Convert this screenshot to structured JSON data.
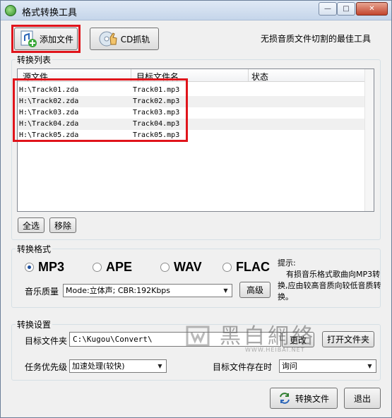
{
  "window": {
    "title": "格式转换工具",
    "min": "—",
    "max": "□",
    "close": "✕"
  },
  "toolbar": {
    "add_file": "添加文件",
    "cd_rip": "CD抓轨",
    "tagline": "无损音质文件切割的最佳工具"
  },
  "convert_list": {
    "label": "转换列表",
    "columns": [
      "源文件",
      "目标文件名",
      "状态"
    ],
    "rows": [
      {
        "src": "H:\\Track01.zda",
        "dst": "Track01.mp3"
      },
      {
        "src": "H:\\Track02.zda",
        "dst": "Track02.mp3"
      },
      {
        "src": "H:\\Track03.zda",
        "dst": "Track03.mp3"
      },
      {
        "src": "H:\\Track04.zda",
        "dst": "Track04.mp3"
      },
      {
        "src": "H:\\Track05.zda",
        "dst": "Track05.mp3"
      }
    ],
    "select_all": "全选",
    "remove": "移除"
  },
  "format": {
    "label": "转换格式",
    "options": [
      "MP3",
      "APE",
      "WAV",
      "FLAC"
    ],
    "selected": "MP3",
    "quality_label": "音乐质量",
    "quality_value": "Mode:立体声; CBR:192Kbps",
    "advanced": "高级",
    "hint_title": "提示:",
    "hint_text": "有损音乐格式歌曲向MP3转换,应由较高音质向较低音质转换。"
  },
  "settings": {
    "label": "转换设置",
    "target_folder_label": "目标文件夹",
    "target_folder_value": "C:\\Kugou\\Convert\\",
    "change": "更改",
    "open_folder": "打开文件夹",
    "priority_label": "任务优先级",
    "priority_value": "加速处理(较快)",
    "exists_label": "目标文件存在时",
    "exists_value": "询问"
  },
  "actions": {
    "convert": "转换文件",
    "exit": "退出"
  },
  "watermark": {
    "text": "黑白網絡",
    "url": "WWW.HEIBAI.NET"
  },
  "colors": {
    "highlight": "#e0141b",
    "radio_on": "#1b4d9c"
  }
}
